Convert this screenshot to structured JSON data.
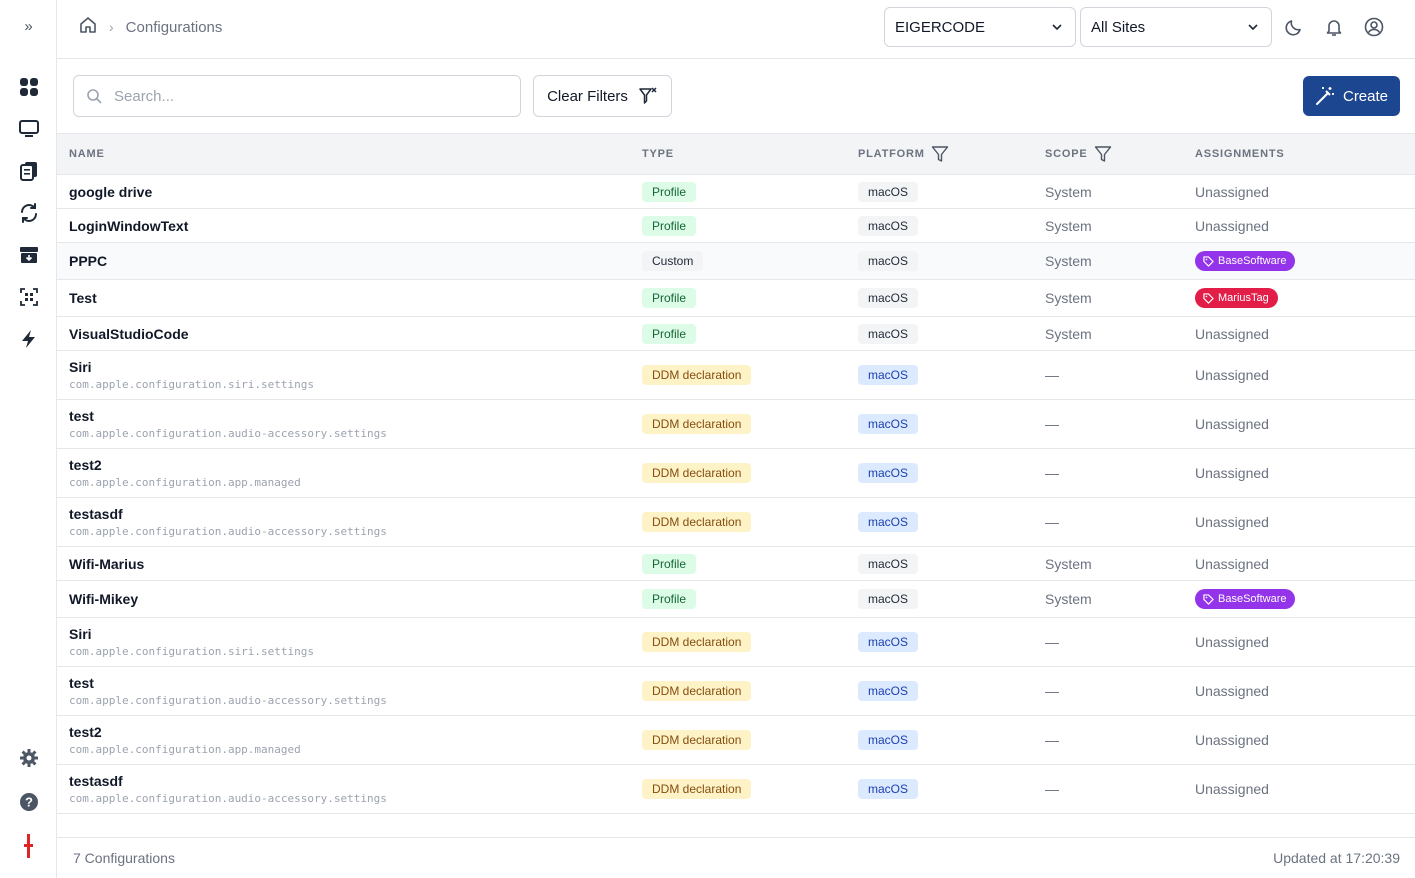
{
  "sidebar": {
    "items": [
      {
        "icon": "dashboard-icon"
      },
      {
        "icon": "monitor-icon"
      },
      {
        "icon": "documents-icon"
      },
      {
        "icon": "sync-icon"
      },
      {
        "icon": "archive-download-icon"
      },
      {
        "icon": "scan-icon"
      },
      {
        "icon": "lightning-icon"
      }
    ],
    "bottom": [
      {
        "icon": "gear-icon"
      },
      {
        "icon": "help-icon"
      },
      {
        "icon": "brand-logo-icon"
      }
    ]
  },
  "header": {
    "breadcrumb": [
      "Configurations"
    ],
    "org_select": "EIGERCODE",
    "site_select": "All Sites"
  },
  "toolbar": {
    "search_placeholder": "Search...",
    "search_value": "",
    "clear_label": "Clear Filters",
    "create_label": "Create"
  },
  "table": {
    "columns": [
      "NAME",
      "TYPE",
      "PLATFORM",
      "SCOPE",
      "ASSIGNMENTS"
    ],
    "rows": [
      {
        "name": "google drive",
        "sub": "",
        "type": "Profile",
        "platform": "macOS",
        "scope": "System",
        "assignment": "Unassigned"
      },
      {
        "name": "LoginWindowText",
        "sub": "",
        "type": "Profile",
        "platform": "macOS",
        "scope": "System",
        "assignment": "Unassigned"
      },
      {
        "name": "PPPC",
        "sub": "",
        "type": "Custom",
        "platform": "macOS",
        "scope": "System",
        "assignment": "BaseSoftware",
        "tag_color": "#9333ea"
      },
      {
        "name": "Test",
        "sub": "",
        "type": "Profile",
        "platform": "macOS",
        "scope": "System",
        "assignment": "MariusTag",
        "tag_color": "#e11d48"
      },
      {
        "name": "VisualStudioCode",
        "sub": "",
        "type": "Profile",
        "platform": "macOS",
        "scope": "System",
        "assignment": "Unassigned"
      },
      {
        "name": "Siri",
        "sub": "com.apple.configuration.siri.settings",
        "type": "DDM declaration",
        "platform": "macOS",
        "scope": "—",
        "assignment": "Unassigned"
      },
      {
        "name": "test",
        "sub": "com.apple.configuration.audio-accessory.settings",
        "type": "DDM declaration",
        "platform": "macOS",
        "scope": "—",
        "assignment": "Unassigned"
      },
      {
        "name": "test2",
        "sub": "com.apple.configuration.app.managed",
        "type": "DDM declaration",
        "platform": "macOS",
        "scope": "—",
        "assignment": "Unassigned"
      },
      {
        "name": "testasdf",
        "sub": "com.apple.configuration.audio-accessory.settings",
        "type": "DDM declaration",
        "platform": "macOS",
        "scope": "—",
        "assignment": "Unassigned"
      },
      {
        "name": "Wifi-Marius",
        "sub": "",
        "type": "Profile",
        "platform": "macOS",
        "scope": "System",
        "assignment": "Unassigned"
      },
      {
        "name": "Wifi-Mikey",
        "sub": "",
        "type": "Profile",
        "platform": "macOS",
        "scope": "System",
        "assignment": "BaseSoftware",
        "tag_color": "#9333ea"
      },
      {
        "name": "Siri",
        "sub": "com.apple.configuration.siri.settings",
        "type": "DDM declaration",
        "platform": "macOS",
        "scope": "—",
        "assignment": "Unassigned"
      },
      {
        "name": "test",
        "sub": "com.apple.configuration.audio-accessory.settings",
        "type": "DDM declaration",
        "platform": "macOS",
        "scope": "—",
        "assignment": "Unassigned"
      },
      {
        "name": "test2",
        "sub": "com.apple.configuration.app.managed",
        "type": "DDM declaration",
        "platform": "macOS",
        "scope": "—",
        "assignment": "Unassigned"
      },
      {
        "name": "testasdf",
        "sub": "com.apple.configuration.audio-accessory.settings",
        "type": "DDM declaration",
        "platform": "macOS",
        "scope": "—",
        "assignment": "Unassigned"
      }
    ]
  },
  "footer": {
    "count": "7 Configurations",
    "updated": "Updated at 17:20:39"
  },
  "colors": {
    "primary": "#1d4690",
    "tag_purple": "#9333ea",
    "tag_red": "#e11d48",
    "brand_red": "#dc2626"
  }
}
